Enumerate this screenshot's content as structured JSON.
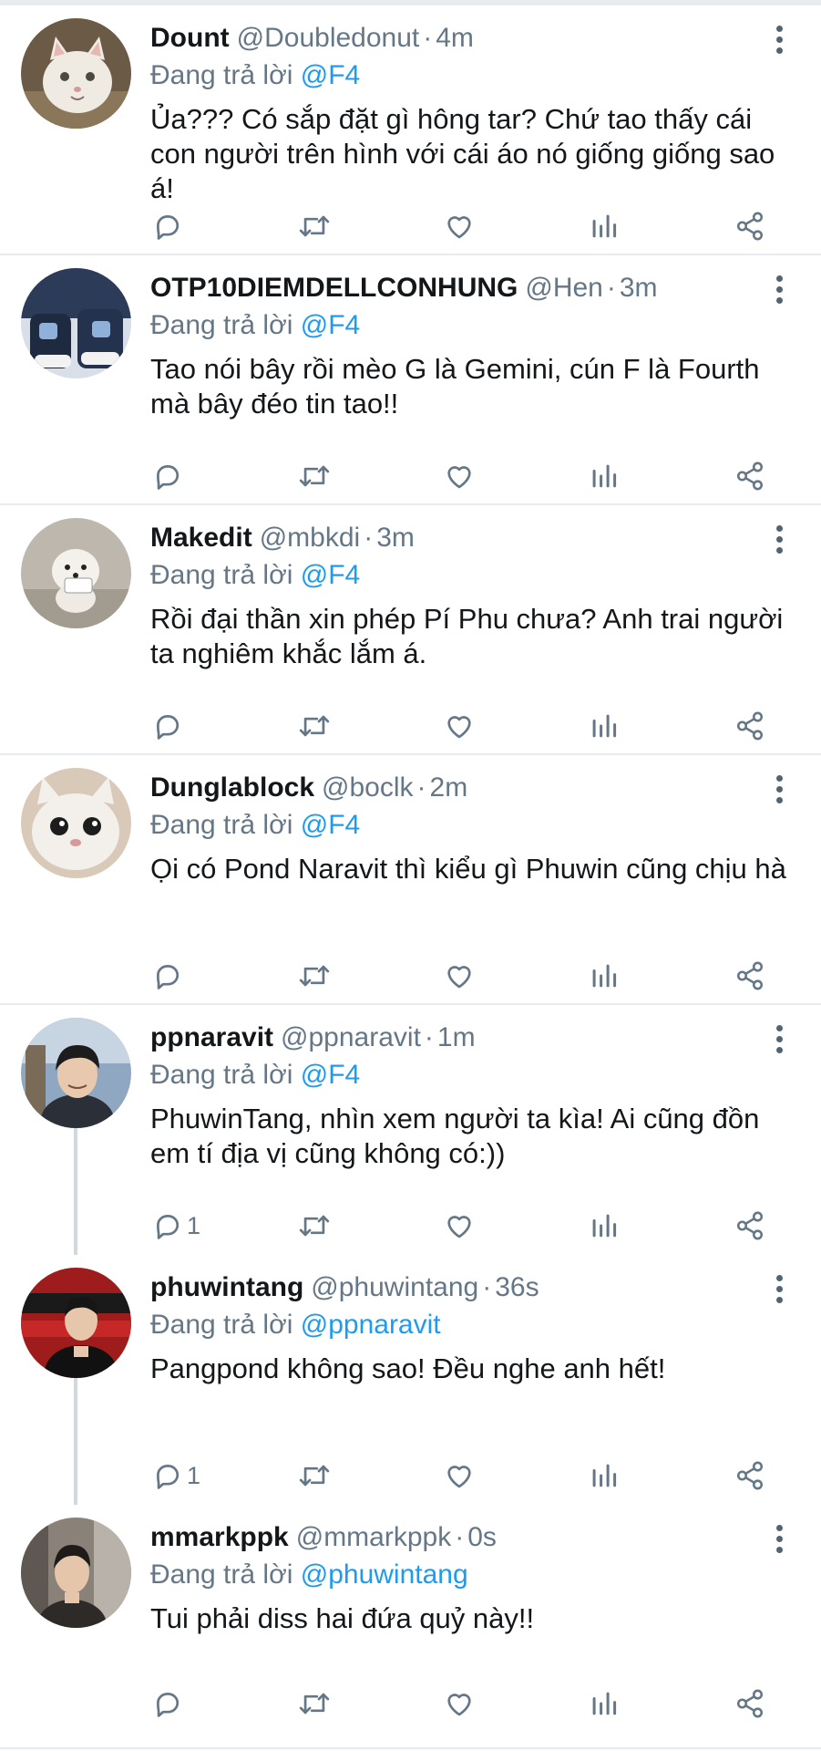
{
  "colors": {
    "mention": "#1d9bf0",
    "secondary_text": "#657786",
    "icon": "#657786",
    "divider": "#e6ecf0"
  },
  "tweets": [
    {
      "name": "Dount",
      "handle": "@Doubledonut",
      "separator": "·",
      "time": "4m",
      "reply_prefix": "Đang trả lời",
      "reply_to": "@F4",
      "text": "Ủa??? Có sắp đặt gì hông tar? Chứ tao thấy cái con người trên hình với cái áo nó giống giống sao á!",
      "reply_count": ""
    },
    {
      "name": "OTP10DIEMDELLCONHUNG",
      "handle": "@Hen",
      "separator": "·",
      "time": "3m",
      "reply_prefix": "Đang trả lời",
      "reply_to": "@F4",
      "text": "Tao nói bây rồi mèo G là Gemini, cún F là Fourth mà bây đéo tin tao!!",
      "reply_count": ""
    },
    {
      "name": "Makedit",
      "handle": "@mbkdi",
      "separator": "·",
      "time": "3m",
      "reply_prefix": "Đang trả lời",
      "reply_to": "@F4",
      "text": "Rồi đại thần xin phép Pí Phu chưa? Anh trai người ta nghiêm khắc lắm á.",
      "reply_count": ""
    },
    {
      "name": "Dunglablock",
      "handle": "@boclk",
      "separator": "·",
      "time": "2m",
      "reply_prefix": "Đang trả lời",
      "reply_to": "@F4",
      "text": "Ọi có Pond Naravit thì kiểu gì Phuwin cũng chịu hà",
      "reply_count": ""
    },
    {
      "name": "ppnaravit",
      "handle": "@ppnaravit",
      "separator": "·",
      "time": "1m",
      "reply_prefix": "Đang trả lời",
      "reply_to": "@F4",
      "text": "PhuwinTang, nhìn xem người ta kìa! Ai cũng đồn em tí địa vị cũng không có:))",
      "reply_count": "1"
    },
    {
      "name": "phuwintang",
      "handle": "@phuwintang",
      "separator": "·",
      "time": "36s",
      "reply_prefix": "Đang trả lời",
      "reply_to": "@ppnaravit",
      "text": "Pangpond không sao! Đều nghe anh hết!",
      "reply_count": "1"
    },
    {
      "name": "mmarkppk",
      "handle": "@mmarkppk",
      "separator": "·",
      "time": "0s",
      "reply_prefix": "Đang trả lời",
      "reply_to": "@phuwintang",
      "text": "Tui phải diss hai đứa quỷ này!!",
      "reply_count": ""
    }
  ]
}
